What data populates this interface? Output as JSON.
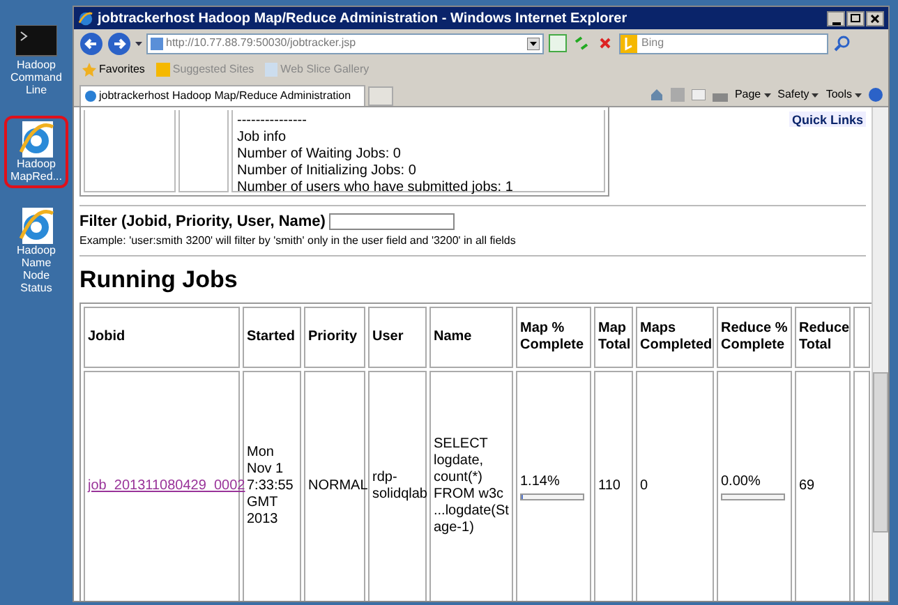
{
  "desktop_icons": [
    {
      "kind": "console",
      "label": "Hadoop Command Line",
      "highlighted": false
    },
    {
      "kind": "browser",
      "label": "Hadoop MapRed...",
      "highlighted": true
    },
    {
      "kind": "browser",
      "label": "Hadoop Name Node Status",
      "highlighted": false
    }
  ],
  "window": {
    "title": "jobtrackerhost Hadoop Map/Reduce Administration - Windows Internet Explorer"
  },
  "address_bar": {
    "value": "http://10.77.88.79:50030/jobtracker.jsp"
  },
  "search": {
    "placeholder": "Bing"
  },
  "favorites_bar": {
    "items": [
      "Favorites",
      "Suggested Sites",
      "Web Slice Gallery"
    ]
  },
  "tabs": [
    {
      "label": "jobtrackerhost Hadoop Map/Reduce Administration",
      "selected": true
    }
  ],
  "command_bar": {
    "items": [
      "Page",
      "Safety",
      "Tools"
    ]
  },
  "quick_links": "Quick Links",
  "cluster_info": {
    "lines": [
      "---------------",
      "Job info",
      "Number of Waiting Jobs: 0",
      "Number of Initializing Jobs: 0",
      "Number of users who have submitted jobs: 1"
    ]
  },
  "filter": {
    "label": "Filter (Jobid, Priority, User, Name)",
    "example": "Example:  'user:smith 3200' will filter by 'smith' only in the user field and '3200' in all fields"
  },
  "running_jobs": {
    "heading": "Running Jobs",
    "columns": [
      "Jobid",
      "Started",
      "Priority",
      "User",
      "Name",
      "Map % Complete",
      "Map Total",
      "Maps Completed",
      "Reduce % Complete",
      "Reduce Total"
    ],
    "rows": [
      {
        "jobid": "job_201311080429_0002",
        "started": "Mon Nov 1 7:33:55 GMT 2013",
        "priority": "NORMAL",
        "user": "rdp-solidqlab",
        "name": "SELECT logdate, count(*) FROM w3c ...logdate(Stage-1)",
        "map_progress": {
          "text": "1.14%",
          "level": 0.0114
        },
        "map_total": "110",
        "maps_completed": "0",
        "reduce_progress": {
          "text": "0.00%",
          "level": 0
        },
        "reduce_total": "69"
      }
    ]
  }
}
